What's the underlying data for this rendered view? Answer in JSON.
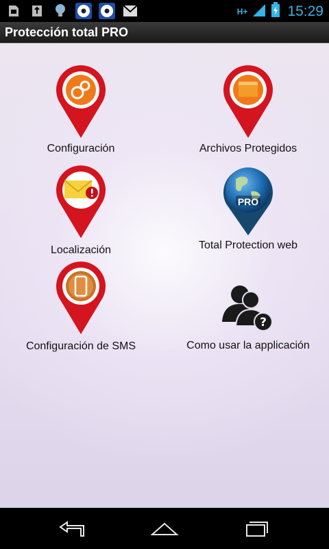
{
  "status_bar": {
    "time": "15:29",
    "network": "H+",
    "icons": [
      "sd-card-icon",
      "usb-icon",
      "lightbulb-icon",
      "soccer-ball-icon",
      "soccer-ball-icon",
      "gmail-icon"
    ]
  },
  "action_bar": {
    "title": "Protección total PRO"
  },
  "menu": {
    "configuracion": "Configuración",
    "archivos": "Archivos Protegidos",
    "localizacion": "Localización",
    "web": "Total Protection web",
    "sms": "Configuración de SMS",
    "ayuda": "Como usar la applicación",
    "pro_badge": "PRO"
  },
  "colors": {
    "pin_red": "#d4141e",
    "accent_blue": "#33b5e5",
    "orange": "#f07a1a"
  }
}
